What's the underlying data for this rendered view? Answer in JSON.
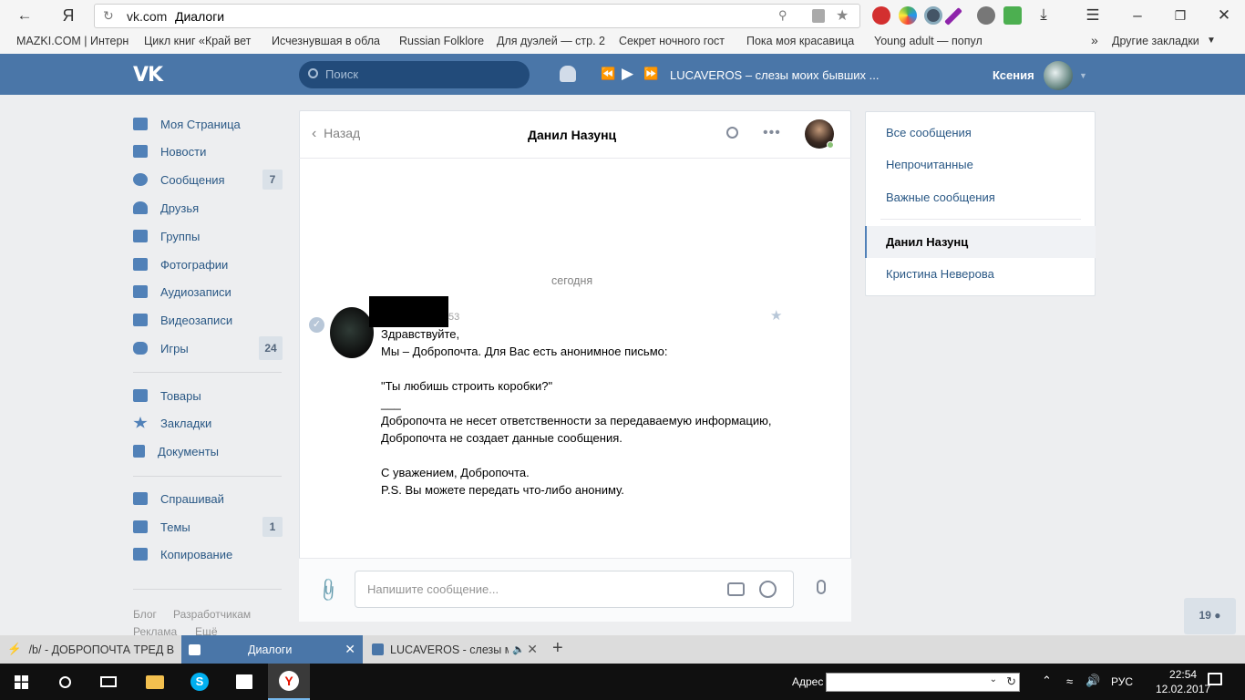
{
  "browser": {
    "url_domain": "vk.com",
    "page_title": "Диалоги",
    "yandex_logo": "Я",
    "bookmarks": [
      "MAZKI.COM | Интерн",
      "Цикл книг «Край вет",
      "Исчезнувшая в обла",
      "Russian Folklore",
      "Для дуэлей — стр. 2",
      "Секрет ночного гост",
      "Пока моя красавица",
      "Young adult — попул"
    ],
    "bookmarks_more": "»",
    "other_bookmarks": "Другие закладки",
    "tabs": [
      {
        "label": "/b/ - ДОБРОПОЧТА ТРЕД В"
      },
      {
        "label": "Диалоги"
      },
      {
        "label": "LUCAVEROS - слезы м"
      }
    ]
  },
  "vk": {
    "logo": "VK",
    "search_placeholder": "Поиск",
    "player_track": "LUCAVEROS – слезы моих бывших ...",
    "user_name": "Ксения",
    "menu": [
      {
        "label": "Моя Страница",
        "count": ""
      },
      {
        "label": "Новости",
        "count": ""
      },
      {
        "label": "Сообщения",
        "count": "7"
      },
      {
        "label": "Друзья",
        "count": ""
      },
      {
        "label": "Группы",
        "count": ""
      },
      {
        "label": "Фотографии",
        "count": ""
      },
      {
        "label": "Аудиозаписи",
        "count": ""
      },
      {
        "label": "Видеозаписи",
        "count": ""
      },
      {
        "label": "Игры",
        "count": "24"
      },
      {
        "label": "Товары",
        "count": ""
      },
      {
        "label": "Закладки",
        "count": ""
      },
      {
        "label": "Документы",
        "count": ""
      },
      {
        "label": "Спрашивай",
        "count": ""
      },
      {
        "label": "Темы",
        "count": "1"
      },
      {
        "label": "Копирование",
        "count": ""
      }
    ],
    "footer": {
      "blog": "Блог",
      "dev": "Разработчикам",
      "ads": "Реклама",
      "more": "Ещё"
    },
    "dialog": {
      "back": "Назад",
      "title": "Данил Назунц",
      "date_divider": "сегодня",
      "message_time": "53",
      "message_text": "Здравствуйте,\nМы – Добропочта. Для Вас есть анонимное письмо:\n\n\"Ты любишь строить коробки?\"\n___\nДобропочта не несет ответственности за передаваемую информацию, Добропочта не создает данные сообщения.\n\nС уважением, Добропочта.\nP.S. Вы можете передать что-либо анониму.",
      "compose_placeholder": "Напишите сообщение..."
    },
    "right_panel": {
      "all": "Все сообщения",
      "unread": "Непрочитанные",
      "important": "Важные сообщения",
      "conv1": "Данил Назунц",
      "conv2": "Кристина Неверова"
    },
    "online_counter": "19"
  },
  "taskbar": {
    "address_label": "Адрес",
    "lang": "РУС",
    "time": "22:54",
    "date": "12.02.2017"
  }
}
